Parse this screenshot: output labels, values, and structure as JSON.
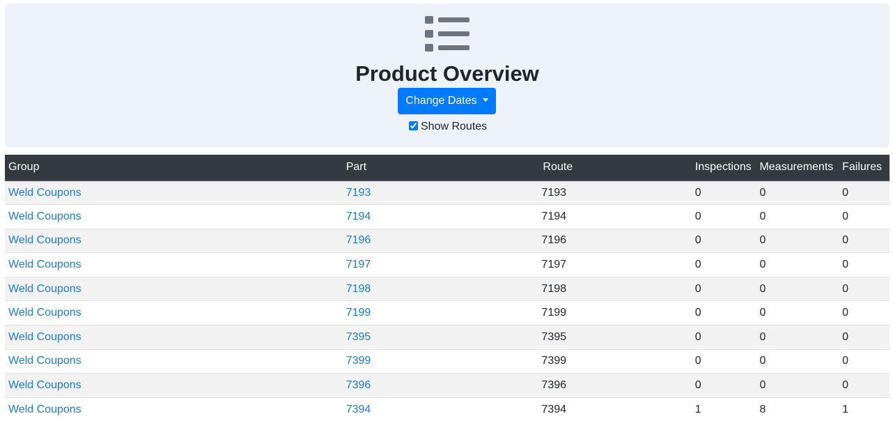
{
  "header": {
    "icon": "list-icon",
    "title": "Product Overview",
    "change_dates_label": "Change Dates",
    "show_routes_label": "Show Routes",
    "show_routes_checked": true
  },
  "colors": {
    "jumbotron_bg": "#edf1f8",
    "primary": "#007bff",
    "table_header_bg": "#343a40",
    "link": "#1b7bd6"
  },
  "table": {
    "columns": [
      "Group",
      "Part",
      "Route",
      "Inspections",
      "Measurements",
      "Failures"
    ],
    "rows": [
      {
        "group": "Weld Coupons",
        "part": "7193",
        "route": "7193",
        "inspections": "0",
        "measurements": "0",
        "failures": "0"
      },
      {
        "group": "Weld Coupons",
        "part": "7194",
        "route": "7194",
        "inspections": "0",
        "measurements": "0",
        "failures": "0"
      },
      {
        "group": "Weld Coupons",
        "part": "7196",
        "route": "7196",
        "inspections": "0",
        "measurements": "0",
        "failures": "0"
      },
      {
        "group": "Weld Coupons",
        "part": "7197",
        "route": "7197",
        "inspections": "0",
        "measurements": "0",
        "failures": "0"
      },
      {
        "group": "Weld Coupons",
        "part": "7198",
        "route": "7198",
        "inspections": "0",
        "measurements": "0",
        "failures": "0"
      },
      {
        "group": "Weld Coupons",
        "part": "7199",
        "route": "7199",
        "inspections": "0",
        "measurements": "0",
        "failures": "0"
      },
      {
        "group": "Weld Coupons",
        "part": "7395",
        "route": "7395",
        "inspections": "0",
        "measurements": "0",
        "failures": "0"
      },
      {
        "group": "Weld Coupons",
        "part": "7399",
        "route": "7399",
        "inspections": "0",
        "measurements": "0",
        "failures": "0"
      },
      {
        "group": "Weld Coupons",
        "part": "7396",
        "route": "7396",
        "inspections": "0",
        "measurements": "0",
        "failures": "0"
      },
      {
        "group": "Weld Coupons",
        "part": "7394",
        "route": "7394",
        "inspections": "1",
        "measurements": "8",
        "failures": "1"
      }
    ]
  }
}
